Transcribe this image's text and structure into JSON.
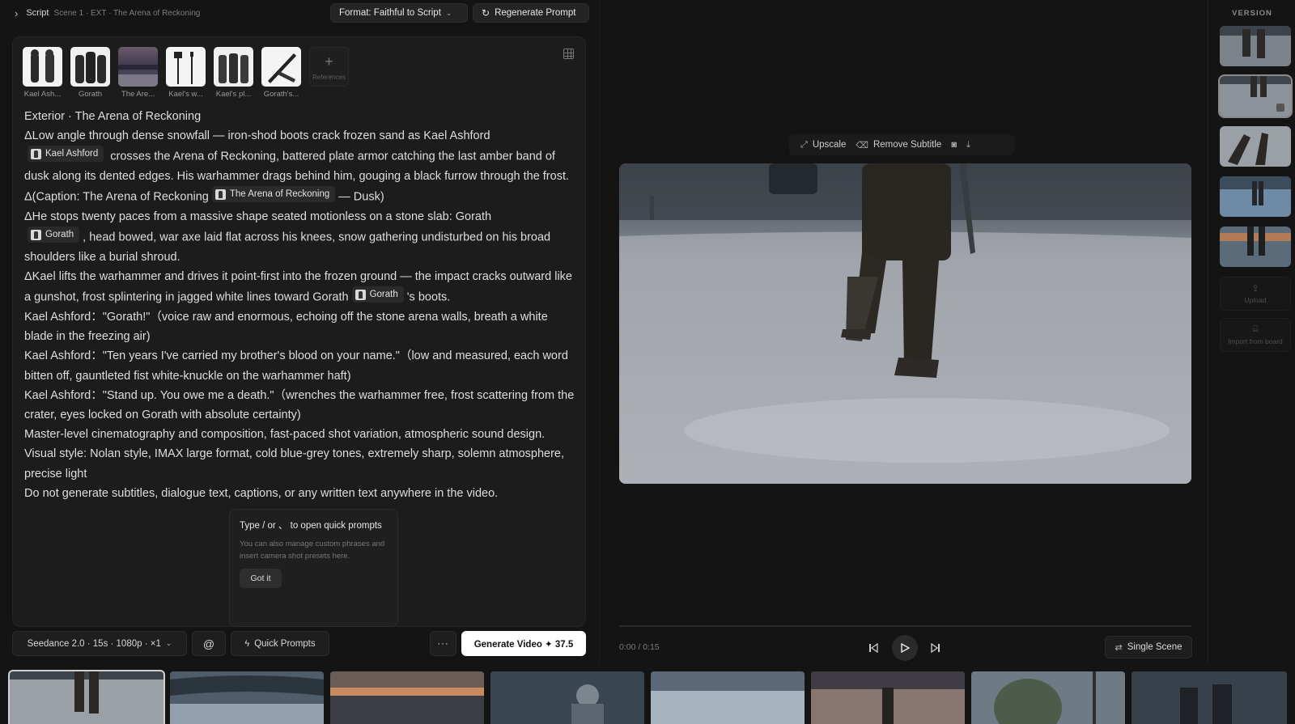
{
  "header": {
    "section": "Script",
    "scene": "Scene 1 · EXT · The Arena of Reckoning",
    "format_button": "Format: Faithful to Script",
    "regenerate_button": "Regenerate Prompt"
  },
  "references": {
    "items": [
      {
        "label": "Kael Ash..."
      },
      {
        "label": "Gorath"
      },
      {
        "label": "The Are..."
      },
      {
        "label": "Kael's w..."
      },
      {
        "label": "Kael's pl..."
      },
      {
        "label": "Gorath's..."
      }
    ],
    "add_label": "References"
  },
  "script": {
    "heading": "Exterior · The Arena of Reckoning",
    "p1a": "ΔLow angle through dense snowfall — iron-shod boots crack frozen sand as Kael Ashford",
    "p1_tag": "Kael Ashford",
    "p1b": "crosses the Arena of Reckoning, battered plate armor catching the last amber band of dusk along its dented edges. His warhammer drags behind him, gouging a black furrow through the frost.",
    "p2a": "Δ(Caption: The Arena of Reckoning",
    "p2_tag": "The Arena of Reckoning",
    "p2b": "— Dusk)",
    "p3a": "ΔHe stops twenty paces from a massive shape seated motionless on a stone slab: Gorath",
    "p3_tag": "Gorath",
    "p3b": ", head bowed, war axe laid flat across his knees, snow gathering undisturbed on his broad shoulders like a burial shroud.",
    "p4a": "ΔKael lifts the warhammer and drives it point-first into the frozen ground — the impact cracks outward like a gunshot, frost splintering in jagged white lines toward Gorath",
    "p4_tag": "Gorath",
    "p4b": "'s boots.",
    "p5": "Kael Ashford：\"Gorath!\"（voice raw and enormous, echoing off the stone arena walls, breath a white blade in the freezing air)",
    "p6": "Kael Ashford：\"Ten years I've carried my brother's blood on your name.\"（low and measured, each word bitten off, gauntleted fist white-knuckle on the warhammer haft)",
    "p7": "Kael Ashford：\"Stand up. You owe me a death.\"（wrenches the warhammer free, frost scattering from the crater, eyes locked on Gorath with absolute certainty)",
    "p8": "Master-level cinematography and composition, fast-paced shot variation, atmospheric sound design.",
    "p9": "Visual style: Nolan style, IMAX large format, cold blue-grey tones, extremely sharp, solemn atmosphere, precise light",
    "p10": "Do not generate subtitles, dialogue text, captions, or any written text anywhere in the video."
  },
  "tooltip": {
    "title": "Type / or 、 to open quick prompts",
    "body": "You can also manage custom phrases and insert camera shot presets here.",
    "button": "Got it"
  },
  "toolbar": {
    "model": "Seedance 2.0 · 15s · 1080p · ×1",
    "mention": "@",
    "quick_prompts": "Quick Prompts",
    "more": "···",
    "generate": "Generate Video ✦ 37.5"
  },
  "preview": {
    "upscale": "Upscale",
    "remove_subtitle": "Remove Subtitle",
    "time": "0:00 / 0:15",
    "single_scene": "Single Scene"
  },
  "versions": {
    "title": "VERSION",
    "upload": "Upload",
    "import": "Import from board"
  },
  "icons": {
    "chevron": "chevron-right-icon",
    "grid": "grid-icon",
    "refresh": "refresh-icon",
    "play": "play-icon"
  },
  "colors": {
    "background": "#141414",
    "panel": "#1c1c1c",
    "primary_button": "#ffffff"
  }
}
